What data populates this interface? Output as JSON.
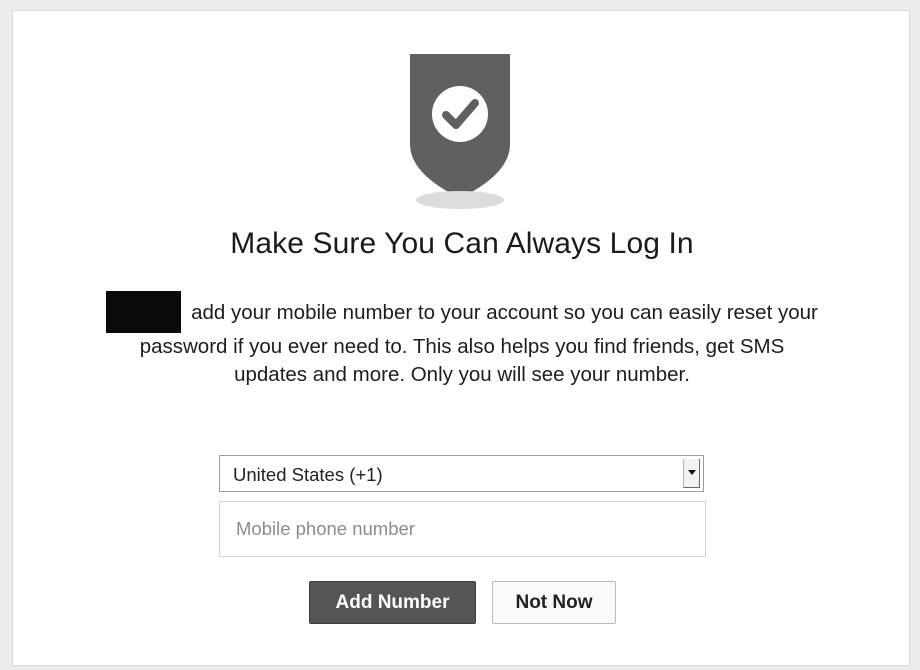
{
  "dialog": {
    "title": "Make Sure You Can Always Log In",
    "description": "add your mobile number to your account so you can easily reset your password if you ever need to. This also helps you find friends, get SMS updates and more. Only you will see your number.",
    "shield_icon": "shield-check-icon",
    "country_select": {
      "value": "United States (+1)",
      "arrow_icon": "chevron-down-icon"
    },
    "phone_input": {
      "placeholder": "Mobile phone number",
      "value": ""
    },
    "buttons": {
      "primary": "Add Number",
      "secondary": "Not Now"
    }
  },
  "colors": {
    "shield": "#606060",
    "primary_button": "#555555",
    "background": "#ececec"
  }
}
